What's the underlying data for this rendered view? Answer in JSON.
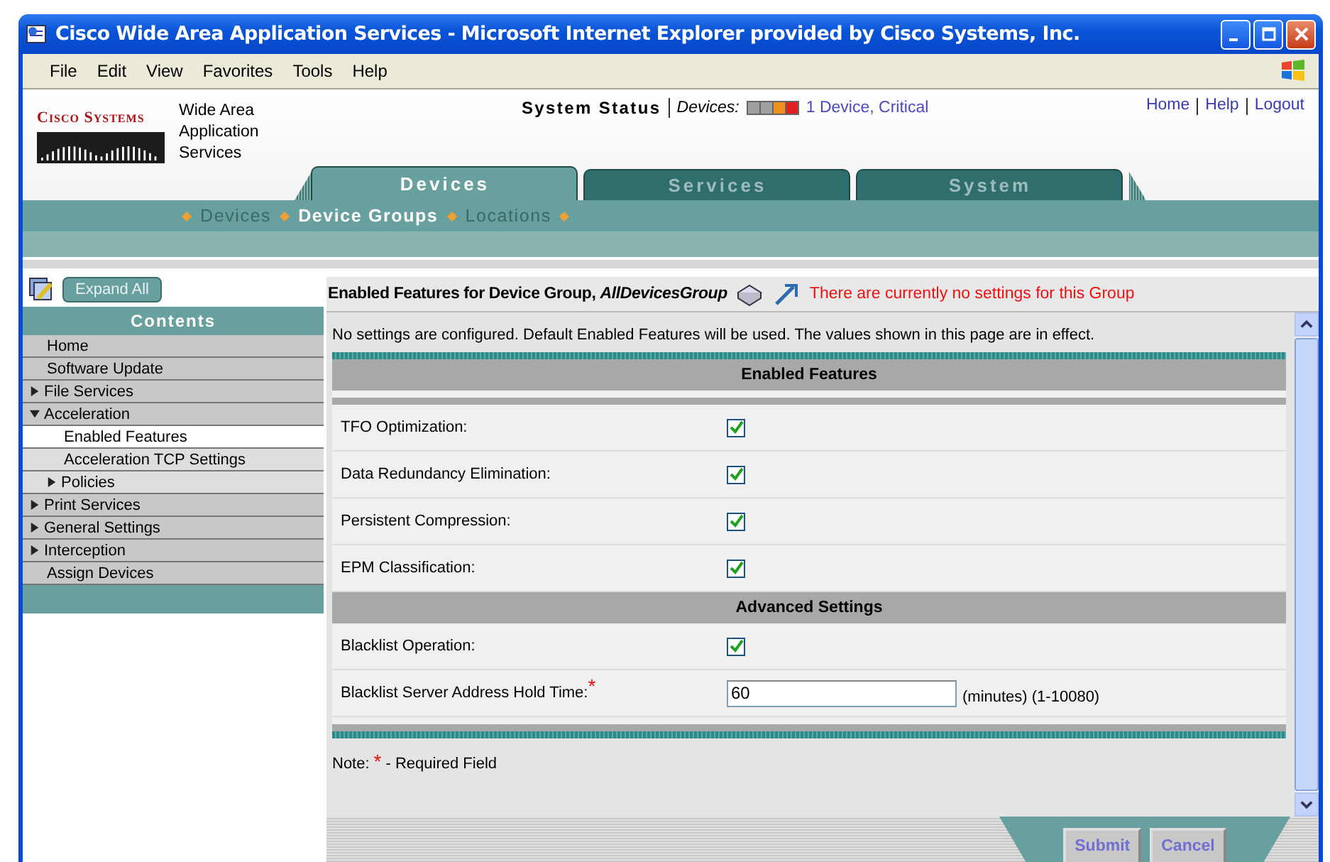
{
  "window": {
    "title": "Cisco Wide Area Application Services - Microsoft Internet Explorer provided by Cisco Systems, Inc."
  },
  "menu": [
    "File",
    "Edit",
    "View",
    "Favorites",
    "Tools",
    "Help"
  ],
  "header": {
    "logo_text": "Cisco Systems",
    "product": "Wide Area Application Services",
    "status_label": "System Status",
    "devices_label": "Devices:",
    "lights": [
      {
        "color": "#a0a0a0"
      },
      {
        "color": "#a0a0a0"
      },
      {
        "color": "#f09020"
      },
      {
        "color": "#e02020"
      }
    ],
    "devices_link": "1 Device, Critical",
    "links": [
      "Home",
      "Help",
      "Logout"
    ]
  },
  "tabs": [
    {
      "label": "Devices",
      "selected": true
    },
    {
      "label": "Services",
      "selected": false
    },
    {
      "label": "System",
      "selected": false
    }
  ],
  "subnav": [
    {
      "label": "Devices",
      "selected": false
    },
    {
      "label": "Device Groups",
      "selected": true
    },
    {
      "label": "Locations",
      "selected": false
    }
  ],
  "sidebar": {
    "expand_button": "Expand All",
    "heading": "Contents",
    "items": [
      {
        "label": "Home",
        "kind": "link",
        "selected": false
      },
      {
        "label": "Software Update",
        "kind": "link",
        "selected": false
      },
      {
        "label": "File Services",
        "kind": "folder",
        "expanded": false,
        "selected": false
      },
      {
        "label": "Acceleration",
        "kind": "folder",
        "expanded": true,
        "selected": false,
        "children": [
          {
            "label": "Enabled Features",
            "kind": "link",
            "selected": true
          },
          {
            "label": "Acceleration TCP Settings",
            "kind": "link",
            "selected": false
          },
          {
            "label": "Policies",
            "kind": "folder",
            "expanded": false,
            "selected": false
          }
        ]
      },
      {
        "label": "Print Services",
        "kind": "folder",
        "expanded": false,
        "selected": false
      },
      {
        "label": "General Settings",
        "kind": "folder",
        "expanded": false,
        "selected": false
      },
      {
        "label": "Interception",
        "kind": "folder",
        "expanded": false,
        "selected": false
      },
      {
        "label": "Assign Devices",
        "kind": "link",
        "selected": false
      }
    ]
  },
  "page": {
    "title": "Enabled Features for Device Group, *AllDevicesGroup*",
    "warning": "There are currently no settings for this Group",
    "note": "No settings are configured. Default Enabled Features will be used. The values shown in this page are in effect.",
    "sections": [
      {
        "heading": "Enabled Features",
        "rows": [
          {
            "kind": "checkbox",
            "label": "TFO Optimization:",
            "checked": true
          },
          {
            "kind": "checkbox",
            "label": "Data Redundancy Elimination:",
            "checked": true
          },
          {
            "kind": "checkbox",
            "label": "Persistent Compression:",
            "checked": true
          },
          {
            "kind": "checkbox",
            "label": "EPM Classification:",
            "checked": true
          }
        ]
      },
      {
        "heading": "Advanced Settings",
        "rows": [
          {
            "kind": "checkbox",
            "label": "Blacklist Operation:",
            "checked": true
          },
          {
            "kind": "number",
            "label": "Blacklist Server Address Hold Time:",
            "required": true,
            "value": "60",
            "hint": "(minutes) (1-10080)"
          }
        ]
      }
    ],
    "required_note": {
      "prefix": "Note:",
      "mark": "*",
      "text": "- Required Field"
    },
    "buttons": [
      "Submit",
      "Cancel"
    ]
  }
}
